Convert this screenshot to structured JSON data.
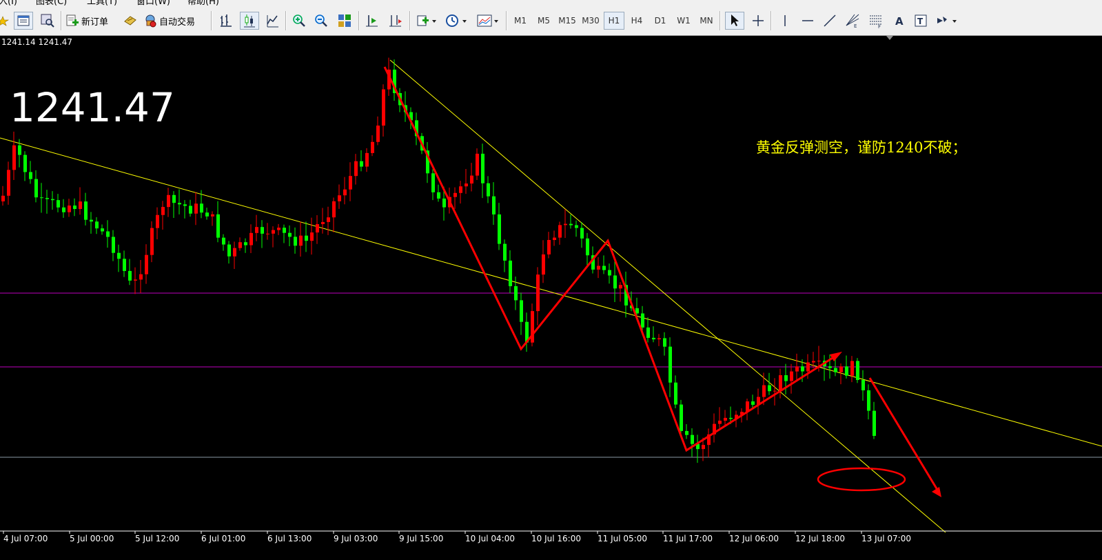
{
  "menu": [
    "入(I)",
    "图表(C)",
    "工具(T)",
    "窗口(W)",
    "帮助(H)"
  ],
  "toolbar": {
    "new_order": "新订单",
    "auto_trading": "自动交易",
    "timeframes": [
      "M1",
      "M5",
      "M15",
      "M30",
      "H1",
      "H4",
      "D1",
      "W1",
      "MN"
    ],
    "active_timeframe": "H1",
    "icons": [
      "star-icon",
      "profiles-icon",
      "zoom-window-icon",
      "new-order-icon",
      "bulb-icon",
      "auto-trading-icon",
      "bar-chart-icon",
      "candlestick-icon",
      "line-chart-icon",
      "zoom-in-icon",
      "zoom-out-icon",
      "tile-windows-icon",
      "chart-shift-icon",
      "autoscroll-icon",
      "indicators-icon",
      "periods-icon",
      "templates-icon",
      "cursor-icon",
      "crosshair-icon",
      "vertical-line-icon",
      "horizontal-line-icon",
      "trendline-icon",
      "gann-icon",
      "fibonacci-icon",
      "text-icon",
      "text-label-icon",
      "arrows-icon"
    ]
  },
  "chart": {
    "bid_ask": "1241.14 1241.47",
    "current_price": "1241.47",
    "annotation": "黄金反弹测空，谨防1240不破；",
    "x_labels": [
      "4 Jul 07:00",
      "5 Jul 00:00",
      "5 Jul 12:00",
      "6 Jul 01:00",
      "6 Jul 13:00",
      "9 Jul 03:00",
      "9 Jul 15:00",
      "10 Jul 04:00",
      "10 Jul 16:00",
      "11 Jul 05:00",
      "11 Jul 17:00",
      "12 Jul 06:00",
      "12 Jul 18:00",
      "13 Jul 07:00"
    ],
    "colors": {
      "background": "#000000",
      "bull": "#ff0000",
      "bear": "#00ff00",
      "trendline": "#ffff00",
      "level": "#c000c0",
      "bid_line": "#8c9aa6",
      "arrows": "#ff0000",
      "annotation": "#ffff00",
      "price": "#ffffff"
    }
  }
}
